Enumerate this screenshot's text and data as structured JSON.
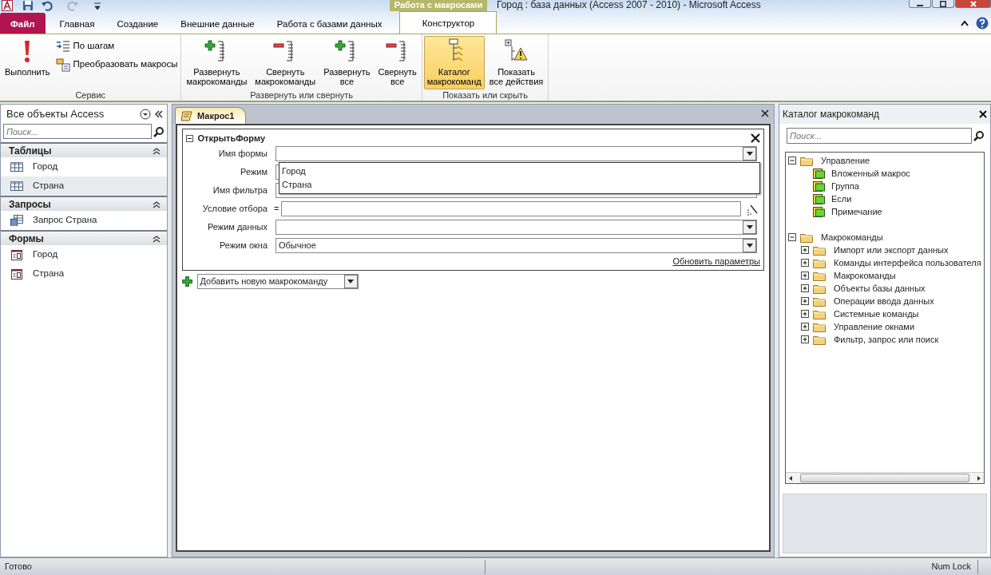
{
  "window": {
    "title": "Город : база данных (Access 2007 - 2010)  -  Microsoft Access"
  },
  "contextual_group": "Работа с макросами",
  "tabs": [
    {
      "label": "Файл",
      "kind": "file",
      "selected": false
    },
    {
      "label": "Главная",
      "kind": "normal",
      "selected": false
    },
    {
      "label": "Создание",
      "kind": "normal",
      "selected": false
    },
    {
      "label": "Внешние данные",
      "kind": "normal",
      "selected": false
    },
    {
      "label": "Работа с базами данных",
      "kind": "normal",
      "selected": false
    },
    {
      "label": "Конструктор",
      "kind": "contextual",
      "selected": true
    }
  ],
  "ribbon": [
    {
      "label": "Сервис",
      "buttons": [
        {
          "label": "Выполнить",
          "kind": "large",
          "selected": false
        },
        {
          "label": "По шагам",
          "kind": "small",
          "selected": false
        },
        {
          "label": "Преобразовать макросы",
          "kind": "small",
          "selected": false
        }
      ]
    },
    {
      "label": "Развернуть или свернуть",
      "buttons": [
        {
          "label": "Развернуть\nмакрокоманды",
          "kind": "large",
          "selected": false
        },
        {
          "label": "Свернуть\nмакрокоманды",
          "kind": "large",
          "selected": false
        },
        {
          "label": "Развернуть\nвсе",
          "kind": "large",
          "selected": false
        },
        {
          "label": "Свернуть\nвсе",
          "kind": "large",
          "selected": false
        }
      ]
    },
    {
      "label": "Показать или скрыть",
      "buttons": [
        {
          "label": "Каталог\nмакрокоманд",
          "kind": "large",
          "selected": true
        },
        {
          "label": "Показать\nвсе действия",
          "kind": "large",
          "selected": false
        }
      ]
    }
  ],
  "nav_pane": {
    "title": "Все объекты Access",
    "search": {
      "placeholder": "Поиск..."
    },
    "sections": [
      {
        "title": "Таблицы",
        "items": [
          {
            "label": "Город",
            "kind": "table",
            "selected": false
          },
          {
            "label": "Страна",
            "kind": "table",
            "selected": true
          }
        ]
      },
      {
        "title": "Запросы",
        "items": [
          {
            "label": "Запрос Страна",
            "kind": "query",
            "selected": false
          }
        ]
      },
      {
        "title": "Формы",
        "items": [
          {
            "label": "Город",
            "kind": "form",
            "selected": false
          },
          {
            "label": "Страна",
            "kind": "form",
            "selected": false
          }
        ]
      }
    ]
  },
  "document_tabs": [
    {
      "label": "Макрос1",
      "selected": true
    }
  ],
  "macro_action": {
    "title": "ОткрытьФорму",
    "expanded": true,
    "arguments": [
      {
        "label": "Имя формы",
        "kind": "dropdown",
        "options": [
          "Город",
          "Страна"
        ]
      },
      {
        "label": "Режим",
        "kind": "dropdown"
      },
      {
        "label": "Имя фильтра",
        "kind": "text"
      },
      {
        "label": "Условие отбора",
        "kind": "expression",
        "prefix": "="
      },
      {
        "label": "Режим данных",
        "kind": "dropdown"
      },
      {
        "label": "Режим окна",
        "kind": "dropdown",
        "value": "Обычное"
      }
    ],
    "link": "Обновить параметры"
  },
  "add_action": {
    "value": "Добавить новую макрокоманду"
  },
  "catalog": {
    "title": "Каталог макрокоманд",
    "search": {
      "placeholder": "Поиск..."
    },
    "tree": [
      {
        "label": "Управление",
        "kind": "folder",
        "expanded": true,
        "children": [
          {
            "label": "Вложенный макрос",
            "kind": "action"
          },
          {
            "label": "Группа",
            "kind": "action"
          },
          {
            "label": "Если",
            "kind": "action"
          },
          {
            "label": "Примечание",
            "kind": "action"
          }
        ]
      },
      {
        "label": "Макрокоманды",
        "kind": "folder",
        "expanded": true,
        "children": [
          {
            "label": "Импорт или экспорт данных",
            "kind": "folder",
            "expanded": false
          },
          {
            "label": "Команды интерфейса пользователя",
            "kind": "folder",
            "expanded": false
          },
          {
            "label": "Макрокоманды",
            "kind": "folder",
            "expanded": false
          },
          {
            "label": "Объекты базы данных",
            "kind": "folder",
            "expanded": false
          },
          {
            "label": "Операции ввода данных",
            "kind": "folder",
            "expanded": false
          },
          {
            "label": "Системные команды",
            "kind": "folder",
            "expanded": false
          },
          {
            "label": "Управление окнами",
            "kind": "folder",
            "expanded": false
          },
          {
            "label": "Фильтр, запрос или поиск",
            "kind": "folder",
            "expanded": false
          }
        ]
      }
    ]
  },
  "status_bar": {
    "left": "Готово",
    "right": "Num Lock"
  }
}
